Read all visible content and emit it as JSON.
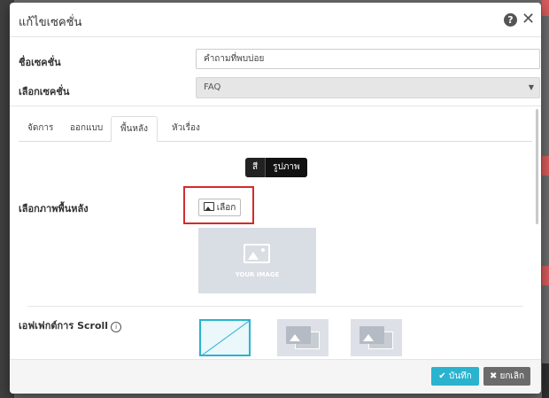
{
  "modal": {
    "title": "แก้ไขเซคชั่น",
    "help": "?",
    "close": "✕"
  },
  "form": {
    "section_name_label": "ชื่อเซคชั่น",
    "section_name_value": "คำถามที่พบบ่อย",
    "select_section_label": "เลือกเซคชั่น",
    "select_section_value": "FAQ"
  },
  "tabs": [
    {
      "label": "จัดการ"
    },
    {
      "label": "ออกแบบ"
    },
    {
      "label": "พื้นหลัง"
    },
    {
      "label": "หัวเรื่อง"
    }
  ],
  "background": {
    "toggle_color": "สี",
    "toggle_image": "รูปภาพ",
    "choose_bg_label": "เลือกภาพพื้นหลัง",
    "choose_button": "เลือก",
    "placeholder_text": "YOUR IMAGE",
    "scroll_effect_label": "เอฟเฟกต์การ Scroll",
    "info": "i"
  },
  "footer": {
    "save": "✔ บันทึก",
    "cancel": "✖ ยกเลิก"
  },
  "colors": {
    "accent": "#29b3cf",
    "highlight": "#d62a2a",
    "cancel": "#6b6b6b"
  }
}
